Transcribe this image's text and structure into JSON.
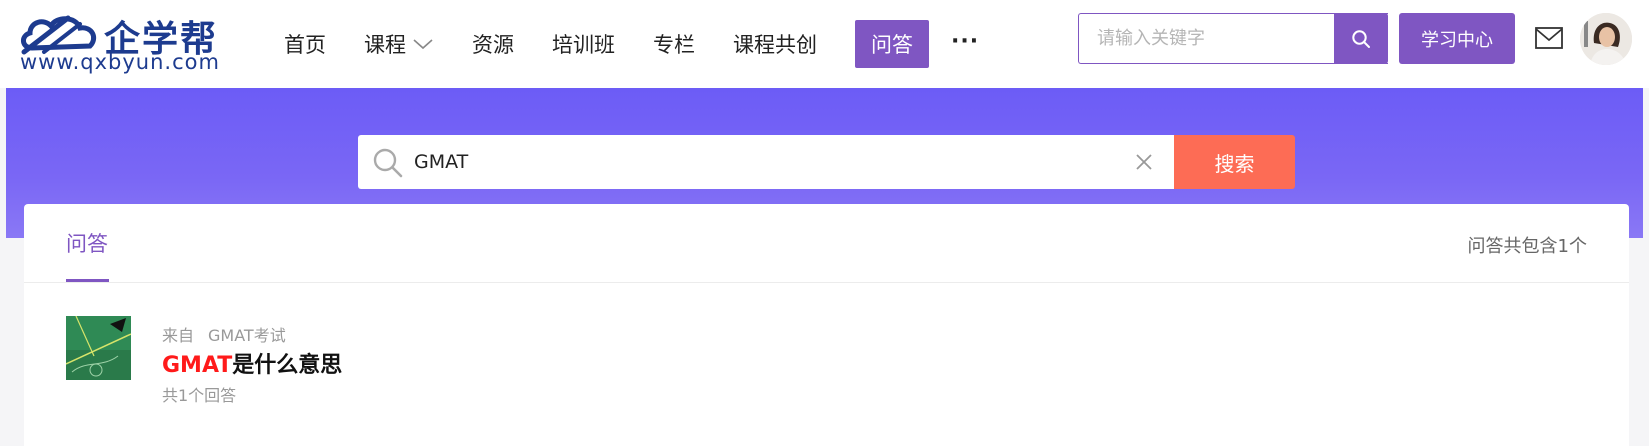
{
  "logo": {
    "text": "企学帮",
    "url": "www.qxbyun.com"
  },
  "nav": {
    "items": [
      {
        "label": "首页"
      },
      {
        "label": "课程"
      },
      {
        "label": "资源"
      },
      {
        "label": "培训班"
      },
      {
        "label": "专栏"
      },
      {
        "label": "课程共创"
      },
      {
        "label": "问答"
      }
    ],
    "more": "···"
  },
  "header_search": {
    "placeholder": "请输入关键字"
  },
  "learn_center": "学习中心",
  "banner_search": {
    "value": "GMAT",
    "button": "搜索"
  },
  "results": {
    "tab": "问答",
    "count": "问答共包含1个",
    "item": {
      "from_label": "来自",
      "from_value": "GMAT考试",
      "title_highlight": "GMAT",
      "title_rest": "是什么意思",
      "answers": "共1个回答"
    }
  },
  "colors": {
    "accent": "#7f56c2",
    "search_button": "#fd6c55",
    "highlight": "#ff1a1a"
  }
}
